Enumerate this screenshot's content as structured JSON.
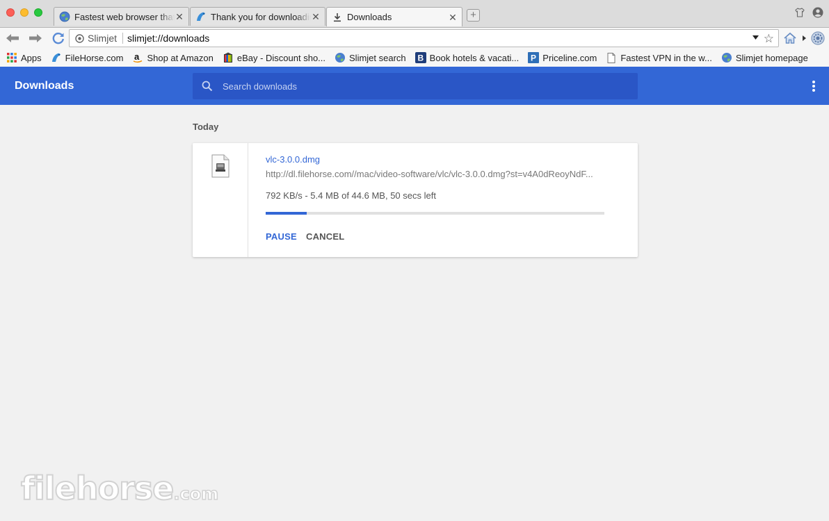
{
  "window": {
    "tabs": [
      {
        "title": "Fastest web browser that",
        "icon": "globe-icon",
        "active": false
      },
      {
        "title": "Thank you for downloading",
        "icon": "filehorse-icon",
        "active": false
      },
      {
        "title": "Downloads",
        "icon": "download-icon",
        "active": true
      }
    ],
    "new_tab_symbol": "+"
  },
  "toolbar": {
    "site_chip": "Slimjet",
    "url": "slimjet://downloads"
  },
  "bookmarks": [
    {
      "label": "Apps",
      "icon": "apps-grid-icon"
    },
    {
      "label": "FileHorse.com",
      "icon": "filehorse-icon"
    },
    {
      "label": "Shop at Amazon",
      "icon": "amazon-icon"
    },
    {
      "label": "eBay - Discount sho...",
      "icon": "ebay-icon"
    },
    {
      "label": "Slimjet search",
      "icon": "globe-icon"
    },
    {
      "label": "Book hotels & vacati...",
      "icon": "booking-icon"
    },
    {
      "label": "Priceline.com",
      "icon": "priceline-icon"
    },
    {
      "label": "Fastest VPN in the w...",
      "icon": "page-icon"
    },
    {
      "label": "Slimjet homepage",
      "icon": "globe-icon"
    }
  ],
  "downloads_page": {
    "title": "Downloads",
    "search_placeholder": "Search downloads",
    "date_heading": "Today",
    "item": {
      "file_name": "vlc-3.0.0.dmg",
      "url": "http://dl.filehorse.com//mac/video-software/vlc/vlc-3.0.0.dmg?st=v4A0dReoyNdF...",
      "progress_text": "792 KB/s - 5.4 MB of 44.6 MB, 50 secs left",
      "progress_fraction": 0.121,
      "pause_label": "PAUSE",
      "cancel_label": "CANCEL"
    }
  },
  "watermark": {
    "main": "filehorse",
    "suffix": ".com"
  },
  "colors": {
    "header_blue": "#3367d6",
    "search_blue": "#2a56c6",
    "page_bg": "#f1f1f1",
    "link_blue": "#3367d6"
  }
}
